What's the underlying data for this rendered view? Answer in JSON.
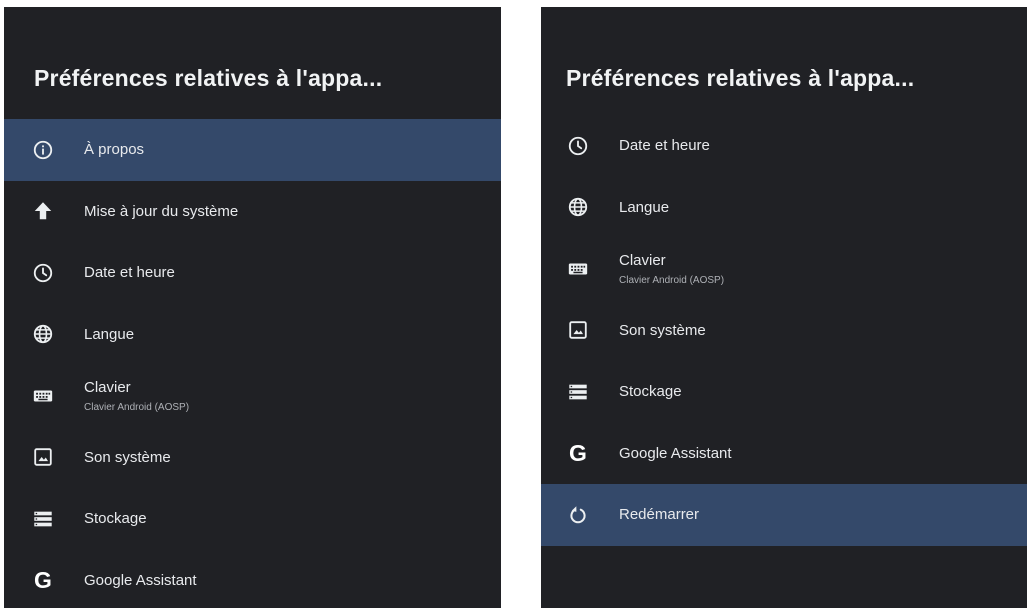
{
  "panels": [
    {
      "title": "Préférences relatives à l'appa...",
      "items": [
        {
          "label": "À propos",
          "icon": "info-icon",
          "selected": true
        },
        {
          "label": "Mise à jour du système",
          "icon": "arrow-up-icon"
        },
        {
          "label": "Date et heure",
          "icon": "clock-icon"
        },
        {
          "label": "Langue",
          "icon": "globe-icon"
        },
        {
          "label": "Clavier",
          "sublabel": "Clavier Android (AOSP)",
          "icon": "keyboard-icon"
        },
        {
          "label": "Son système",
          "icon": "image-icon"
        },
        {
          "label": "Stockage",
          "icon": "storage-icon"
        },
        {
          "label": "Google Assistant",
          "icon": "google-icon"
        }
      ]
    },
    {
      "title": "Préférences relatives à l'appa...",
      "items": [
        {
          "label": "Date et heure",
          "icon": "clock-icon"
        },
        {
          "label": "Langue",
          "icon": "globe-icon"
        },
        {
          "label": "Clavier",
          "sublabel": "Clavier Android (AOSP)",
          "icon": "keyboard-icon"
        },
        {
          "label": "Son système",
          "icon": "image-icon"
        },
        {
          "label": "Stockage",
          "icon": "storage-icon"
        },
        {
          "label": "Google Assistant",
          "icon": "google-icon"
        },
        {
          "label": "Redémarrer",
          "icon": "restart-icon",
          "selected": true
        }
      ]
    }
  ],
  "colors": {
    "panel_background": "#202125",
    "selected_background": "#34496a",
    "text": "#e8eaed"
  }
}
